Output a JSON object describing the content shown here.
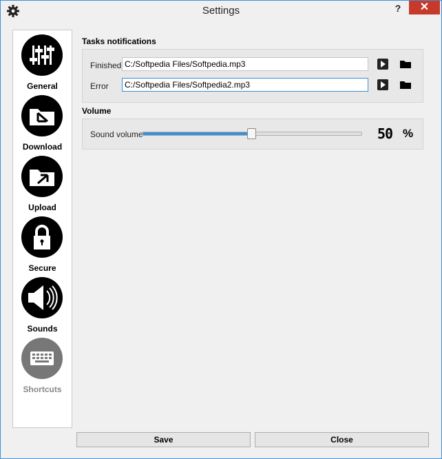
{
  "window": {
    "title": "Settings",
    "help_label": "?",
    "close_label": "✕"
  },
  "sidebar": {
    "items": [
      {
        "label": "General",
        "icon": "sliders-icon"
      },
      {
        "label": "Download",
        "icon": "folder-download-icon"
      },
      {
        "label": "Upload",
        "icon": "folder-upload-icon"
      },
      {
        "label": "Secure",
        "icon": "lock-icon"
      },
      {
        "label": "Sounds",
        "icon": "speaker-icon"
      },
      {
        "label": "Shortcuts",
        "icon": "keyboard-icon",
        "state": "selected"
      }
    ]
  },
  "tasks": {
    "title": "Tasks notifications",
    "finished": {
      "label": "Finished",
      "value": "C:/Softpedia Files/Softpedia.mp3"
    },
    "error": {
      "label": "Error",
      "value": "C:/Softpedia Files/Softpedia2.mp3"
    }
  },
  "volume": {
    "title": "Volume",
    "label": "Sound volume",
    "value": 50,
    "value_display": "50",
    "unit": "%"
  },
  "footer": {
    "save_label": "Save",
    "close_label": "Close"
  },
  "colors": {
    "accent": "#3c8fd6",
    "close_red": "#c7392b",
    "icon_black": "#000000",
    "icon_muted": "#777777"
  }
}
